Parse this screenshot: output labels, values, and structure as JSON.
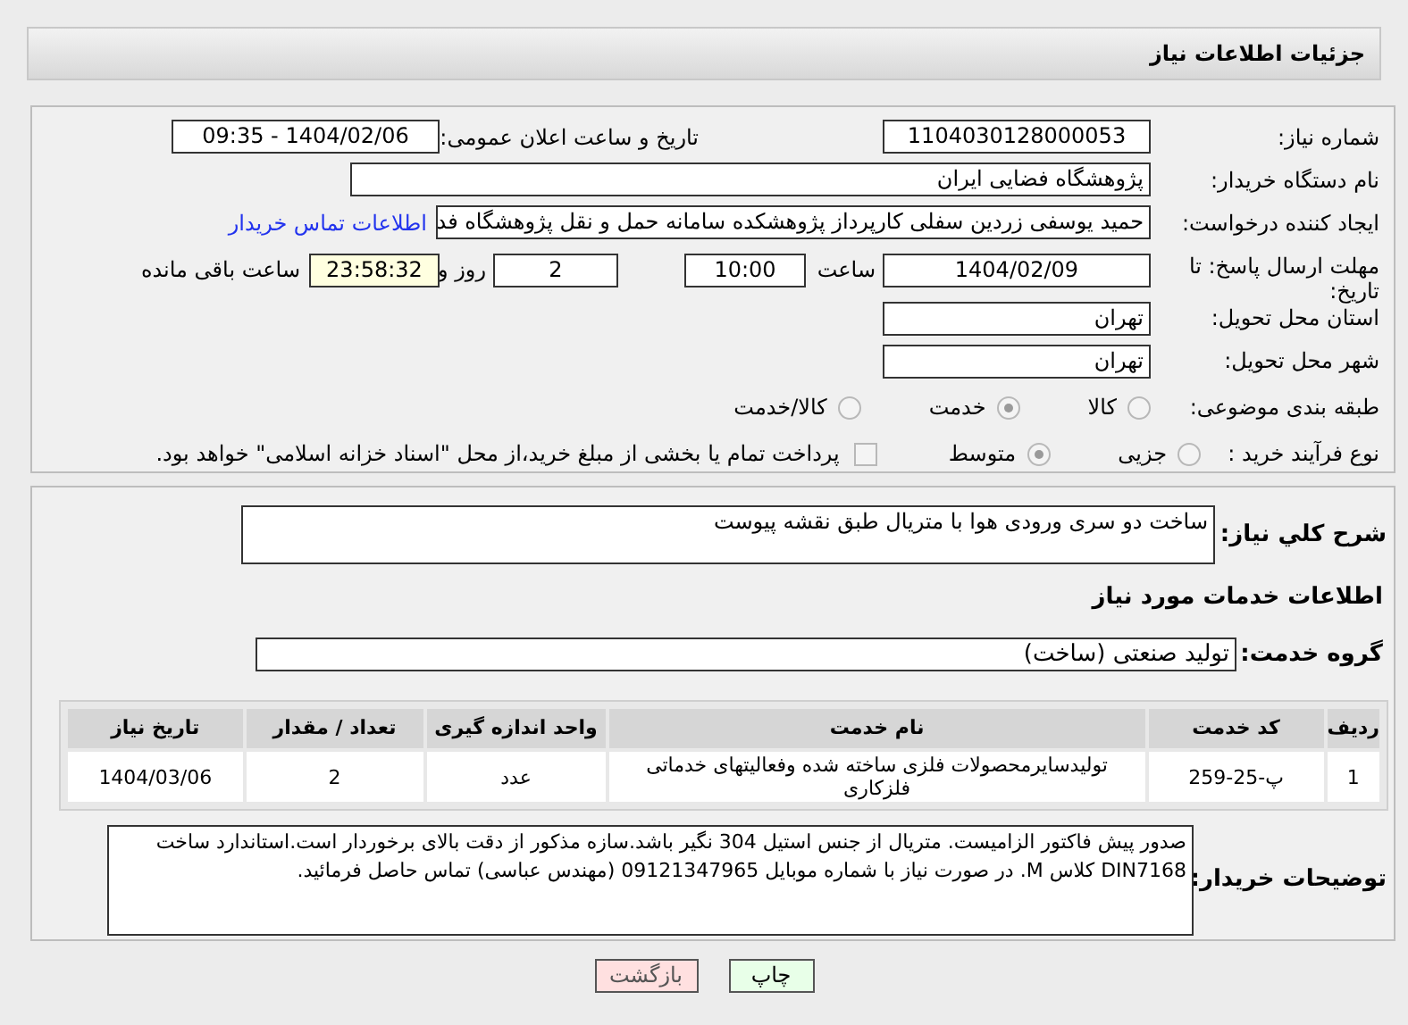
{
  "header": {
    "title": "جزئیات اطلاعات نیاز"
  },
  "need_number": {
    "label": "شماره نیاز:",
    "value": "1104030128000053"
  },
  "announce": {
    "label": "تاریخ و ساعت اعلان عمومی:",
    "value": "1404/02/06 - 09:35"
  },
  "buyer": {
    "label": "نام دستگاه خریدار:",
    "value": "پژوهشگاه فضایی ایران"
  },
  "requester": {
    "label": "ایجاد کننده درخواست:",
    "value": "حمید یوسفی زردین سفلی کارپرداز پژوهشکده سامانه حمل و نقل پژوهشگاه فد",
    "link": "اطلاعات تماس خریدار"
  },
  "deadline": {
    "label": "مهلت ارسال پاسخ: تا تاریخ:",
    "date": "1404/02/09",
    "time_label": "ساعت",
    "time": "10:00",
    "days": "2",
    "days_label": "روز و",
    "remaining": "23:58:32",
    "remaining_label": "ساعت باقی مانده"
  },
  "province": {
    "label": "استان محل تحویل:",
    "value": "تهران"
  },
  "city": {
    "label": "شهر محل تحویل:",
    "value": "تهران"
  },
  "category": {
    "label": "طبقه بندی موضوعی:",
    "options": [
      {
        "label": "کالا",
        "selected": false
      },
      {
        "label": "خدمت",
        "selected": true
      },
      {
        "label": "کالا/خدمت",
        "selected": false
      }
    ]
  },
  "process": {
    "label": "نوع فرآیند خرید :",
    "options": [
      {
        "label": "جزیی",
        "selected": false
      },
      {
        "label": "متوسط",
        "selected": true
      }
    ],
    "payment": {
      "label": "پرداخت تمام یا بخشی از مبلغ خرید،از محل \"اسناد خزانه اسلامی\" خواهد بود.",
      "checked": false
    }
  },
  "summary": {
    "label": "شرح کلي نياز:",
    "value": "ساخت دو سری ورودی هوا با متریال طبق نقشه پیوست"
  },
  "services_heading": "اطلاعات خدمات مورد نیاز",
  "service_group": {
    "label": "گروه خدمت:",
    "value": "تولید صنعتی (ساخت)"
  },
  "table": {
    "columns": [
      "ردیف",
      "کد خدمت",
      "نام خدمت",
      "واحد اندازه گیری",
      "تعداد / مقدار",
      "تاریخ نیاز"
    ],
    "rows": [
      [
        "1",
        "پ-25-259",
        "تولیدسایرمحصولات فلزی ساخته شده وفعالیتهای خدماتی فلزکاری",
        "عدد",
        "2",
        "1404/03/06"
      ]
    ]
  },
  "notes": {
    "label": "توضیحات خریدار:",
    "value": "صدور پیش فاکتور الزامیست. متریال از جنس استیل 304 نگیر باشد.سازه مذکور از دقت بالای برخوردار است.استاندارد ساخت DIN7168 کلاس M. در صورت نیاز با شماره موبایل 09121347965 (مهندس عباسی) تماس حاصل فرمائید."
  },
  "buttons": [
    {
      "label": "چاپ",
      "kind": "print"
    },
    {
      "label": "بازگشت",
      "kind": "back"
    }
  ]
}
